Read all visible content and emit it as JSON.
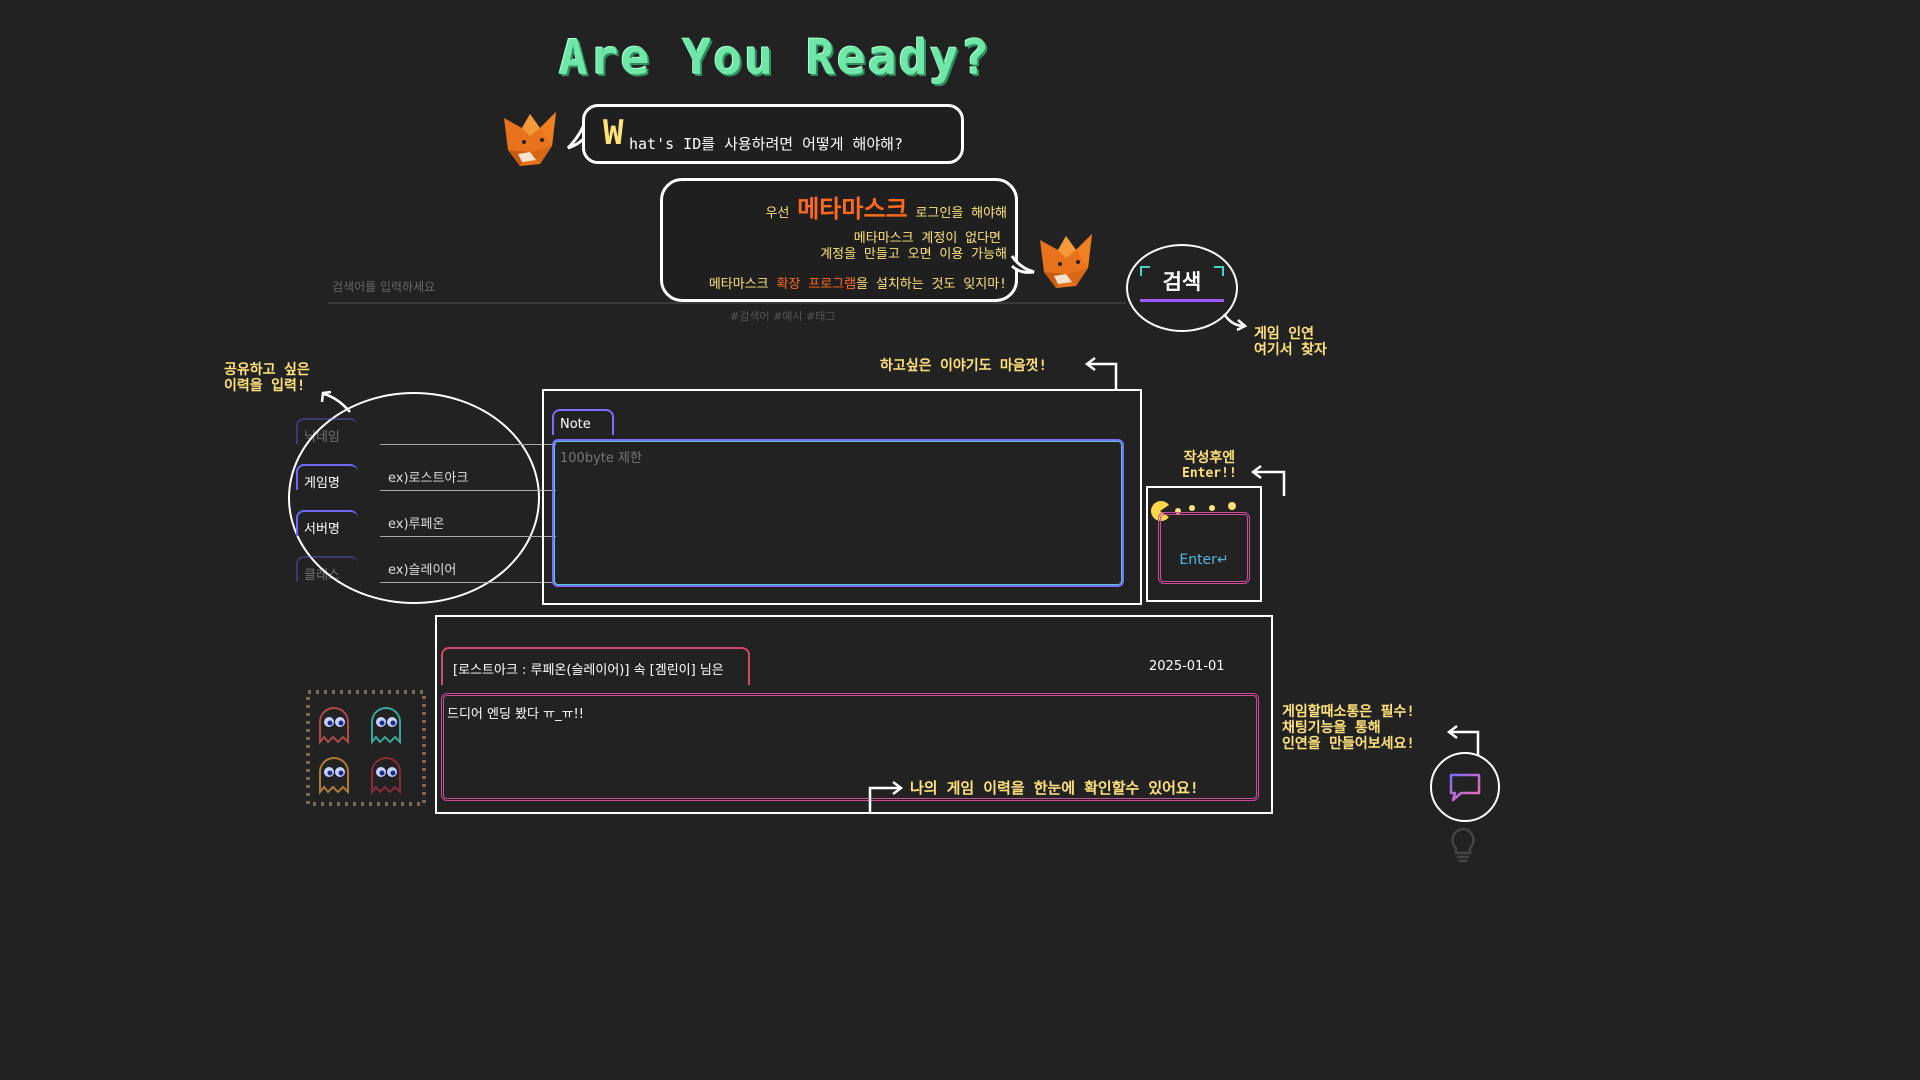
{
  "header": {
    "title": "Are You Ready?",
    "bubble1_big": "W",
    "bubble1_text": "hat's ID를 사용하려면 어떻게 해야해?",
    "bubble2_pre": "우선 ",
    "bubble2_brand": "메타마스크",
    "bubble2_post": " 로그인을 해야해",
    "bubble2_line2": "메타마스크 계정이 없다면",
    "bubble2_line3": "계정을 만들고 오면 이용 가능해",
    "bubble2_line4_a": "메타마스크 ",
    "bubble2_line4_b": "확장 프로그램",
    "bubble2_line4_c": "을 설치하는 것도 잊지마!"
  },
  "search": {
    "placeholder": "검색어를 입력하세요",
    "tags": "#검색어 #예시 #태그",
    "button_label": "검색",
    "annotation_line1": "게임 인연",
    "annotation_line2": "여기서 찾자"
  },
  "form": {
    "annotation_line1": "공유하고 싶은",
    "annotation_line2": "이력을 입력!",
    "fields": [
      {
        "label": "닉네임",
        "placeholder": ""
      },
      {
        "label": "게임명",
        "placeholder": "ex)로스트아크"
      },
      {
        "label": "서버명",
        "placeholder": "ex)루페온"
      },
      {
        "label": "클래스",
        "placeholder": "ex)슬레이어"
      }
    ]
  },
  "note": {
    "annotation": "하고싶은 이야기도 마음껏!",
    "tab_label": "Note",
    "placeholder": "100byte 제한"
  },
  "enter": {
    "annotation_line1": "작성후엔",
    "annotation_line2": "Enter!!",
    "button_label": "Enter↵"
  },
  "record": {
    "title": "[로스트아크 : 루페온(슬레이어)] 속 [겜린이] 님은",
    "date": "2025-01-01",
    "text": "드디어 엔딩 봤다 ㅠ_ㅠ!!",
    "annotation": "나의 게임 이력을 한눈에 확인할수 있어요!"
  },
  "chat": {
    "annotation_line1": "게임할때소통은 필수!",
    "annotation_line2": "채팅기능을 통해",
    "annotation_line3": "인연을 만들어보세요!"
  },
  "colors": {
    "background": "#222222",
    "accent_yellow": "#ffe27a",
    "accent_orange": "#ff6a1a",
    "title_green": "#6ee7a8",
    "purple": "#7b6cff",
    "pink": "#d04a9a"
  }
}
